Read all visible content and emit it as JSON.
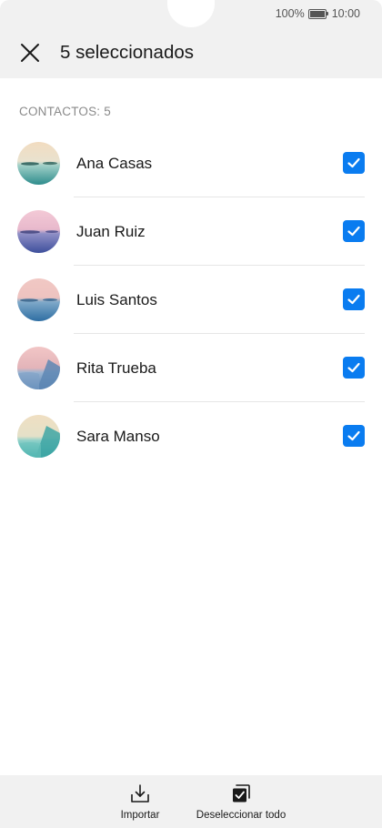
{
  "status_bar": {
    "battery_percent": "100%",
    "time": "10:00"
  },
  "header": {
    "title": "5 seleccionados",
    "close_icon": "close-icon"
  },
  "section": {
    "label": "CONTACTOS: 5"
  },
  "contacts": [
    {
      "name": "Ana Casas",
      "selected": true
    },
    {
      "name": "Juan Ruiz",
      "selected": true
    },
    {
      "name": "Luis Santos",
      "selected": true
    },
    {
      "name": "Rita Trueba",
      "selected": true
    },
    {
      "name": "Sara Manso",
      "selected": true
    }
  ],
  "bottom_bar": {
    "import_label": "Importar",
    "import_icon": "download-icon",
    "deselect_label": "Deseleccionar todo",
    "deselect_icon": "deselect-all-icon"
  },
  "colors": {
    "accent": "#0a7cf0",
    "bar_background": "#f1f1f1"
  }
}
